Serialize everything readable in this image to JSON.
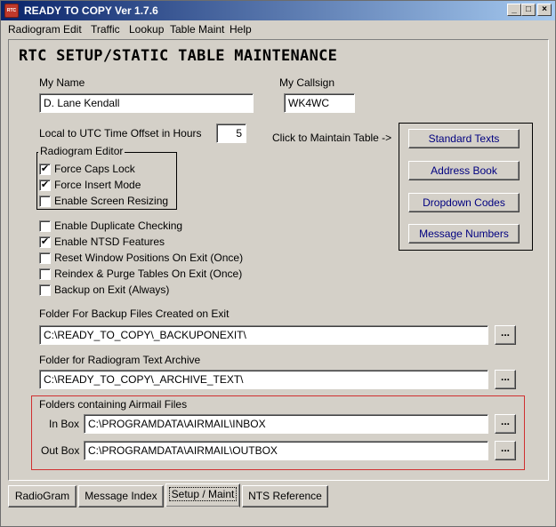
{
  "window": {
    "title": "READY TO COPY Ver 1.7.6",
    "minimize": "_",
    "maximize": "□",
    "close": "×"
  },
  "menu": [
    "Radiogram",
    "Edit",
    "Traffic",
    "Lookup",
    "Table Maint",
    "Help"
  ],
  "header": {
    "title": "RTC SETUP/STATIC TABLE MAINTENANCE"
  },
  "my_name": {
    "label": "My Name",
    "value": "D. Lane Kendall"
  },
  "my_callsign": {
    "label": "My Callsign",
    "value": "WK4WC"
  },
  "utc_offset": {
    "label": "Local to UTC Time Offset in Hours",
    "value": "5"
  },
  "radiogram_editor": {
    "legend": "Radiogram Editor",
    "options": [
      {
        "label": "Force Caps Lock",
        "checked": true
      },
      {
        "label": "Force Insert Mode",
        "checked": true
      },
      {
        "label": "Enable Screen Resizing",
        "checked": false
      }
    ]
  },
  "options": [
    {
      "label": "Enable Duplicate Checking",
      "checked": false
    },
    {
      "label": "Enable NTSD Features",
      "checked": true
    },
    {
      "label": "Reset Window Positions On Exit (Once)",
      "checked": false
    },
    {
      "label": "Reindex & Purge Tables On Exit (Once)",
      "checked": false
    },
    {
      "label": "Backup on Exit (Always)",
      "checked": false
    }
  ],
  "maintain": {
    "label": "Click to Maintain Table ->",
    "buttons": [
      "Standard Texts",
      "Address Book",
      "Dropdown Codes",
      "Message Numbers"
    ]
  },
  "backup_folder": {
    "label": "Folder For Backup Files Created on Exit",
    "value": "C:\\READY_TO_COPY\\_BACKUPONEXIT\\"
  },
  "archive_folder": {
    "label": "Folder for Radiogram Text Archive",
    "value": "C:\\READY_TO_COPY\\_ARCHIVE_TEXT\\"
  },
  "airmail": {
    "legend": "Folders containing Airmail Files",
    "inbox_label": "In Box",
    "inbox_value": "C:\\PROGRAMDATA\\AIRMAIL\\INBOX",
    "outbox_label": "Out Box",
    "outbox_value": "C:\\PROGRAMDATA\\AIRMAIL\\OUTBOX"
  },
  "browse_label": "...",
  "tabs": [
    {
      "label": "RadioGram",
      "active": false
    },
    {
      "label": "Message Index",
      "active": false
    },
    {
      "label": "Setup / Maint",
      "active": true
    },
    {
      "label": "NTS Reference",
      "active": false
    }
  ],
  "colors": {
    "title_start": "#0a246a",
    "title_end": "#a6caf0",
    "button_text": "#000080",
    "airmail_border": "#d03030"
  }
}
